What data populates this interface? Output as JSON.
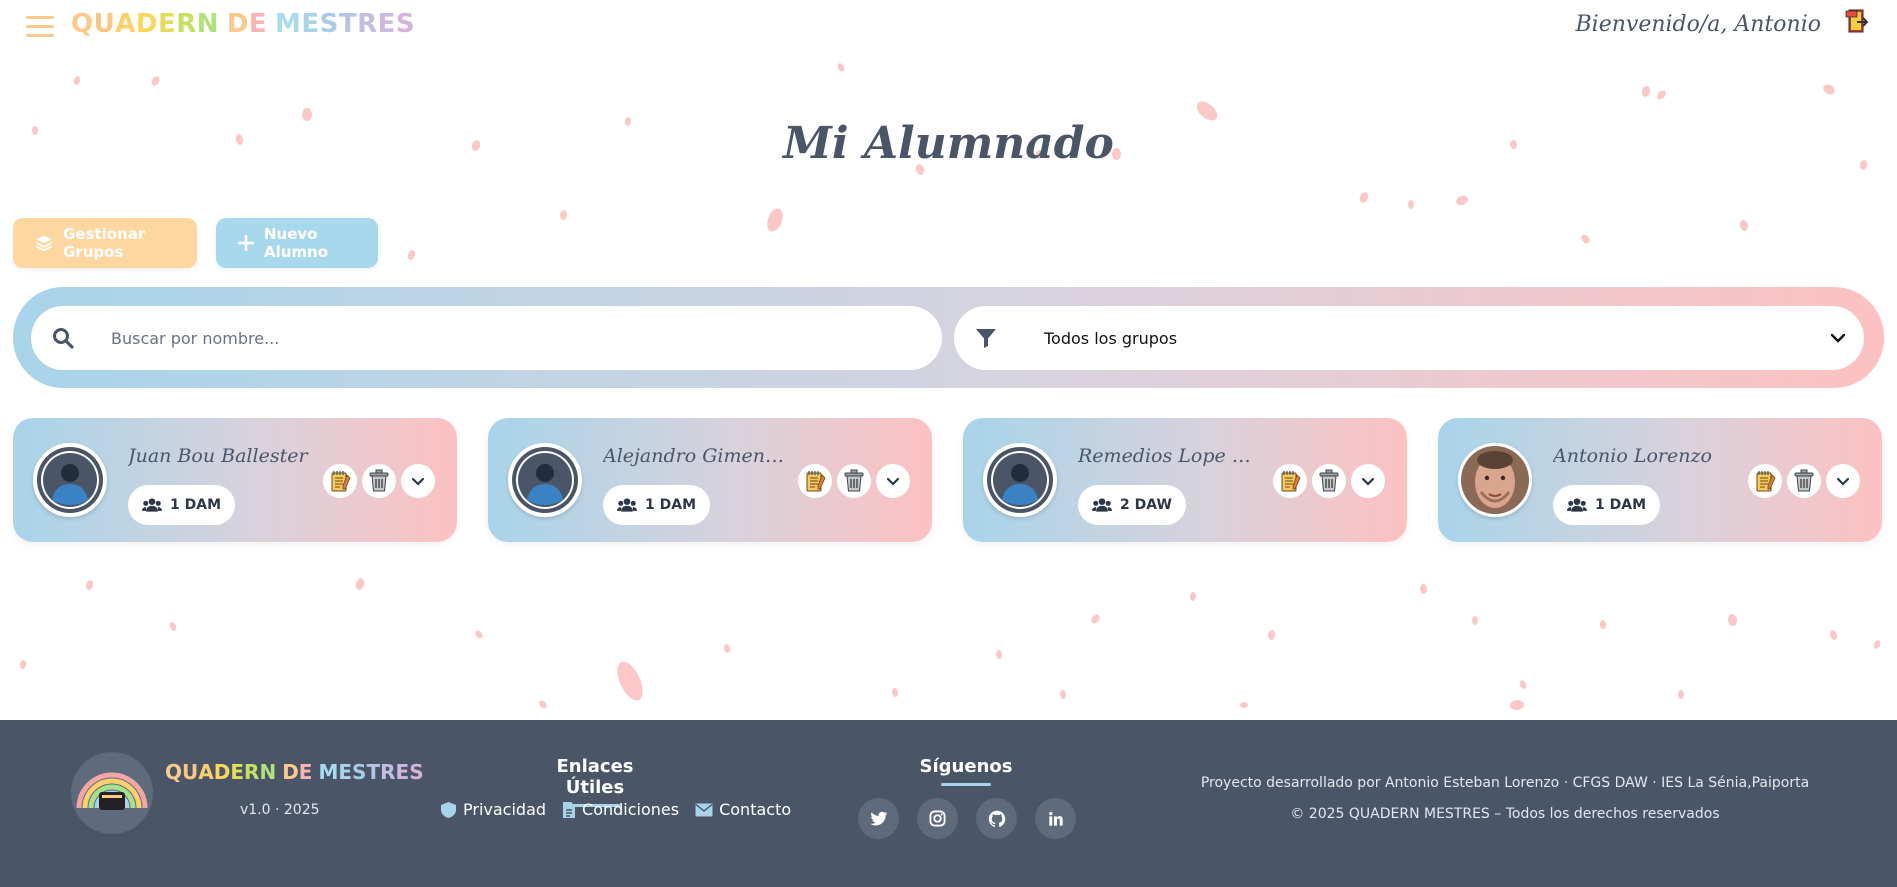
{
  "header": {
    "brand_letters": [
      "Q",
      "U",
      "A",
      "D",
      "E",
      "R",
      "N",
      " ",
      "D",
      "E",
      " ",
      "M",
      "E",
      "S",
      "T",
      "R",
      "E",
      "S"
    ],
    "brand_colors": [
      "#fbc98a",
      "#fdc67e",
      "#fcd06b",
      "#f9d75d",
      "#e5dd5a",
      "#c6e063",
      "#b0e17a",
      "#ffffff",
      "#fbc98a",
      "#fcb3b3",
      "#ffffff",
      "#a7dcef",
      "#a8d4ea",
      "#a9cbe6",
      "#b6c4e4",
      "#c3bde2",
      "#cdb8e0",
      "#d6b3dd"
    ],
    "welcome": "Bienvenido/a, Antonio",
    "menu_icon": "hamburger-icon",
    "logout_icon": "exit-door-icon"
  },
  "page": {
    "title": "Mi Alumnado"
  },
  "actions": {
    "manage_groups_label": "Gestionar Grupos",
    "new_student_label": "Nuevo Alumno"
  },
  "filters": {
    "search_placeholder": "Buscar por nombre...",
    "group_select_value": "Todos los grupos"
  },
  "students": [
    {
      "name": "Juan Bou Ballester",
      "group": "1 DAM",
      "avatar": "default"
    },
    {
      "name": "Alejandro GimenezA...",
      "group": "1 DAM",
      "avatar": "default"
    },
    {
      "name": "Remedios Lope Man...",
      "group": "2 DAW",
      "avatar": "default"
    },
    {
      "name": "Antonio Lorenzo",
      "group": "1 DAM",
      "avatar": "photo"
    }
  ],
  "footer": {
    "brand": "QUADERN DE MESTRES",
    "version": "v1.0 · 2025",
    "links_heading": "Enlaces Útiles",
    "links": [
      "Privacidad",
      "Condiciones",
      "Contacto"
    ],
    "follow_heading": "Síguenos",
    "socials": [
      "twitter-icon",
      "instagram-icon",
      "github-icon",
      "linkedin-icon"
    ],
    "credit_line": "Proyecto desarrollado por Antonio Esteban Lorenzo · CFGS DAW · IES La Sénia,Paiporta",
    "copyright": "© 2025 QUADERN MESTRES – Todos los derechos reservados"
  }
}
